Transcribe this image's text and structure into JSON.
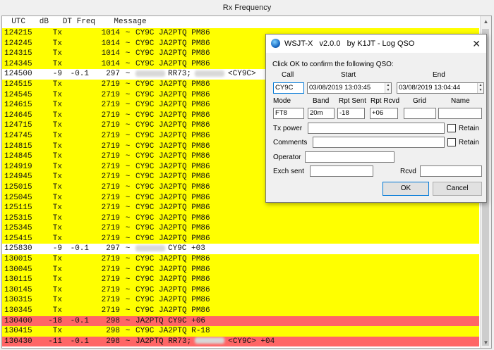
{
  "panel": {
    "title": "Rx Frequency"
  },
  "header": {
    "text": "  UTC   dB   DT Freq    Message"
  },
  "rows": [
    {
      "utc": "124215",
      "db": "Tx",
      "dt": "",
      "freq": "1014",
      "til": "~",
      "msg": "CY9C JA2PTQ PM86",
      "kind": "tx"
    },
    {
      "utc": "124245",
      "db": "Tx",
      "dt": "",
      "freq": "1014",
      "til": "~",
      "msg": "CY9C JA2PTQ PM86",
      "kind": "tx"
    },
    {
      "utc": "124315",
      "db": "Tx",
      "dt": "",
      "freq": "1014",
      "til": "~",
      "msg": "CY9C JA2PTQ PM86",
      "kind": "tx"
    },
    {
      "utc": "124345",
      "db": "Tx",
      "dt": "",
      "freq": "1014",
      "til": "~",
      "msg": "CY9C JA2PTQ PM86",
      "kind": "tx"
    },
    {
      "utc": "124500",
      "db": "-9",
      "dt": "-0.1",
      "freq": "297",
      "til": "~",
      "msg": "RR73;",
      "msg2": "<CY9C>",
      "kind": "rx",
      "blur1": true,
      "blur2": true
    },
    {
      "utc": "124515",
      "db": "Tx",
      "dt": "",
      "freq": "2719",
      "til": "~",
      "msg": "CY9C JA2PTQ PM86",
      "kind": "tx"
    },
    {
      "utc": "124545",
      "db": "Tx",
      "dt": "",
      "freq": "2719",
      "til": "~",
      "msg": "CY9C JA2PTQ PM86",
      "kind": "tx"
    },
    {
      "utc": "124615",
      "db": "Tx",
      "dt": "",
      "freq": "2719",
      "til": "~",
      "msg": "CY9C JA2PTQ PM86",
      "kind": "tx"
    },
    {
      "utc": "124645",
      "db": "Tx",
      "dt": "",
      "freq": "2719",
      "til": "~",
      "msg": "CY9C JA2PTQ PM86",
      "kind": "tx"
    },
    {
      "utc": "124715",
      "db": "Tx",
      "dt": "",
      "freq": "2719",
      "til": "~",
      "msg": "CY9C JA2PTQ PM86",
      "kind": "tx"
    },
    {
      "utc": "124745",
      "db": "Tx",
      "dt": "",
      "freq": "2719",
      "til": "~",
      "msg": "CY9C JA2PTQ PM86",
      "kind": "tx"
    },
    {
      "utc": "124815",
      "db": "Tx",
      "dt": "",
      "freq": "2719",
      "til": "~",
      "msg": "CY9C JA2PTQ PM86",
      "kind": "tx"
    },
    {
      "utc": "124845",
      "db": "Tx",
      "dt": "",
      "freq": "2719",
      "til": "~",
      "msg": "CY9C JA2PTQ PM86",
      "kind": "tx"
    },
    {
      "utc": "124919",
      "db": "Tx",
      "dt": "",
      "freq": "2719",
      "til": "~",
      "msg": "CY9C JA2PTQ PM86",
      "kind": "tx"
    },
    {
      "utc": "124945",
      "db": "Tx",
      "dt": "",
      "freq": "2719",
      "til": "~",
      "msg": "CY9C JA2PTQ PM86",
      "kind": "tx"
    },
    {
      "utc": "125015",
      "db": "Tx",
      "dt": "",
      "freq": "2719",
      "til": "~",
      "msg": "CY9C JA2PTQ PM86",
      "kind": "tx"
    },
    {
      "utc": "125045",
      "db": "Tx",
      "dt": "",
      "freq": "2719",
      "til": "~",
      "msg": "CY9C JA2PTQ PM86",
      "kind": "tx"
    },
    {
      "utc": "125115",
      "db": "Tx",
      "dt": "",
      "freq": "2719",
      "til": "~",
      "msg": "CY9C JA2PTQ PM86",
      "kind": "tx"
    },
    {
      "utc": "125315",
      "db": "Tx",
      "dt": "",
      "freq": "2719",
      "til": "~",
      "msg": "CY9C JA2PTQ PM86",
      "kind": "tx"
    },
    {
      "utc": "125345",
      "db": "Tx",
      "dt": "",
      "freq": "2719",
      "til": "~",
      "msg": "CY9C JA2PTQ PM86",
      "kind": "tx"
    },
    {
      "utc": "125415",
      "db": "Tx",
      "dt": "",
      "freq": "2719",
      "til": "~",
      "msg": "CY9C JA2PTQ PM86",
      "kind": "tx"
    },
    {
      "utc": "125830",
      "db": "-9",
      "dt": "-0.1",
      "freq": "297",
      "til": "~",
      "msg": "CY9C +03",
      "kind": "rx",
      "blur1": true
    },
    {
      "utc": "130015",
      "db": "Tx",
      "dt": "",
      "freq": "2719",
      "til": "~",
      "msg": "CY9C JA2PTQ PM86",
      "kind": "tx"
    },
    {
      "utc": "130045",
      "db": "Tx",
      "dt": "",
      "freq": "2719",
      "til": "~",
      "msg": "CY9C JA2PTQ PM86",
      "kind": "tx"
    },
    {
      "utc": "130115",
      "db": "Tx",
      "dt": "",
      "freq": "2719",
      "til": "~",
      "msg": "CY9C JA2PTQ PM86",
      "kind": "tx"
    },
    {
      "utc": "130145",
      "db": "Tx",
      "dt": "",
      "freq": "2719",
      "til": "~",
      "msg": "CY9C JA2PTQ PM86",
      "kind": "tx"
    },
    {
      "utc": "130315",
      "db": "Tx",
      "dt": "",
      "freq": "2719",
      "til": "~",
      "msg": "CY9C JA2PTQ PM86",
      "kind": "tx"
    },
    {
      "utc": "130345",
      "db": "Tx",
      "dt": "",
      "freq": "2719",
      "til": "~",
      "msg": "CY9C JA2PTQ PM86",
      "kind": "tx"
    },
    {
      "utc": "130400",
      "db": "-18",
      "dt": "-0.1",
      "freq": "298",
      "til": "~",
      "msg": "JA2PTQ CY9C +06",
      "kind": "call"
    },
    {
      "utc": "130415",
      "db": "Tx",
      "dt": "",
      "freq": "298",
      "til": "~",
      "msg": "CY9C JA2PTQ R-18",
      "kind": "tx"
    },
    {
      "utc": "130430",
      "db": "-11",
      "dt": "-0.1",
      "freq": "298",
      "til": "~",
      "msg": "JA2PTQ RR73;",
      "msg2": "<CY9C> +04",
      "kind": "call",
      "blur2": true
    }
  ],
  "colors": {
    "tx_row": "#ffff00",
    "rx_row": "#ffffff",
    "call_row": "#ff6666"
  },
  "dialog": {
    "title": "WSJT-X   v2.0.0   by K1JT - Log QSO",
    "logo_icon": "wsjtx-globe-icon",
    "close_glyph": "✕",
    "prompt": "Click OK to confirm the following QSO:",
    "labels": {
      "call": "Call",
      "start": "Start",
      "end": "End",
      "mode": "Mode",
      "band": "Band",
      "rpt_sent": "Rpt Sent",
      "rpt_rcvd": "Rpt Rcvd",
      "grid": "Grid",
      "name": "Name",
      "tx_power": "Tx power",
      "retain": "Retain",
      "comments": "Comments",
      "operator": "Operator",
      "exch_sent": "Exch sent",
      "rcvd": "Rcvd"
    },
    "values": {
      "call": "CY9C",
      "start": "03/08/2019 13:03:45",
      "end": "03/08/2019 13:04:44",
      "mode": "FT8",
      "band": "20m",
      "rpt_sent": "-18",
      "rpt_rcvd": "+06",
      "grid": "",
      "name": "",
      "tx_power": "",
      "comments": "",
      "operator": "",
      "exch_sent": "",
      "rcvd": ""
    },
    "buttons": {
      "ok": "OK",
      "cancel": "Cancel"
    }
  }
}
